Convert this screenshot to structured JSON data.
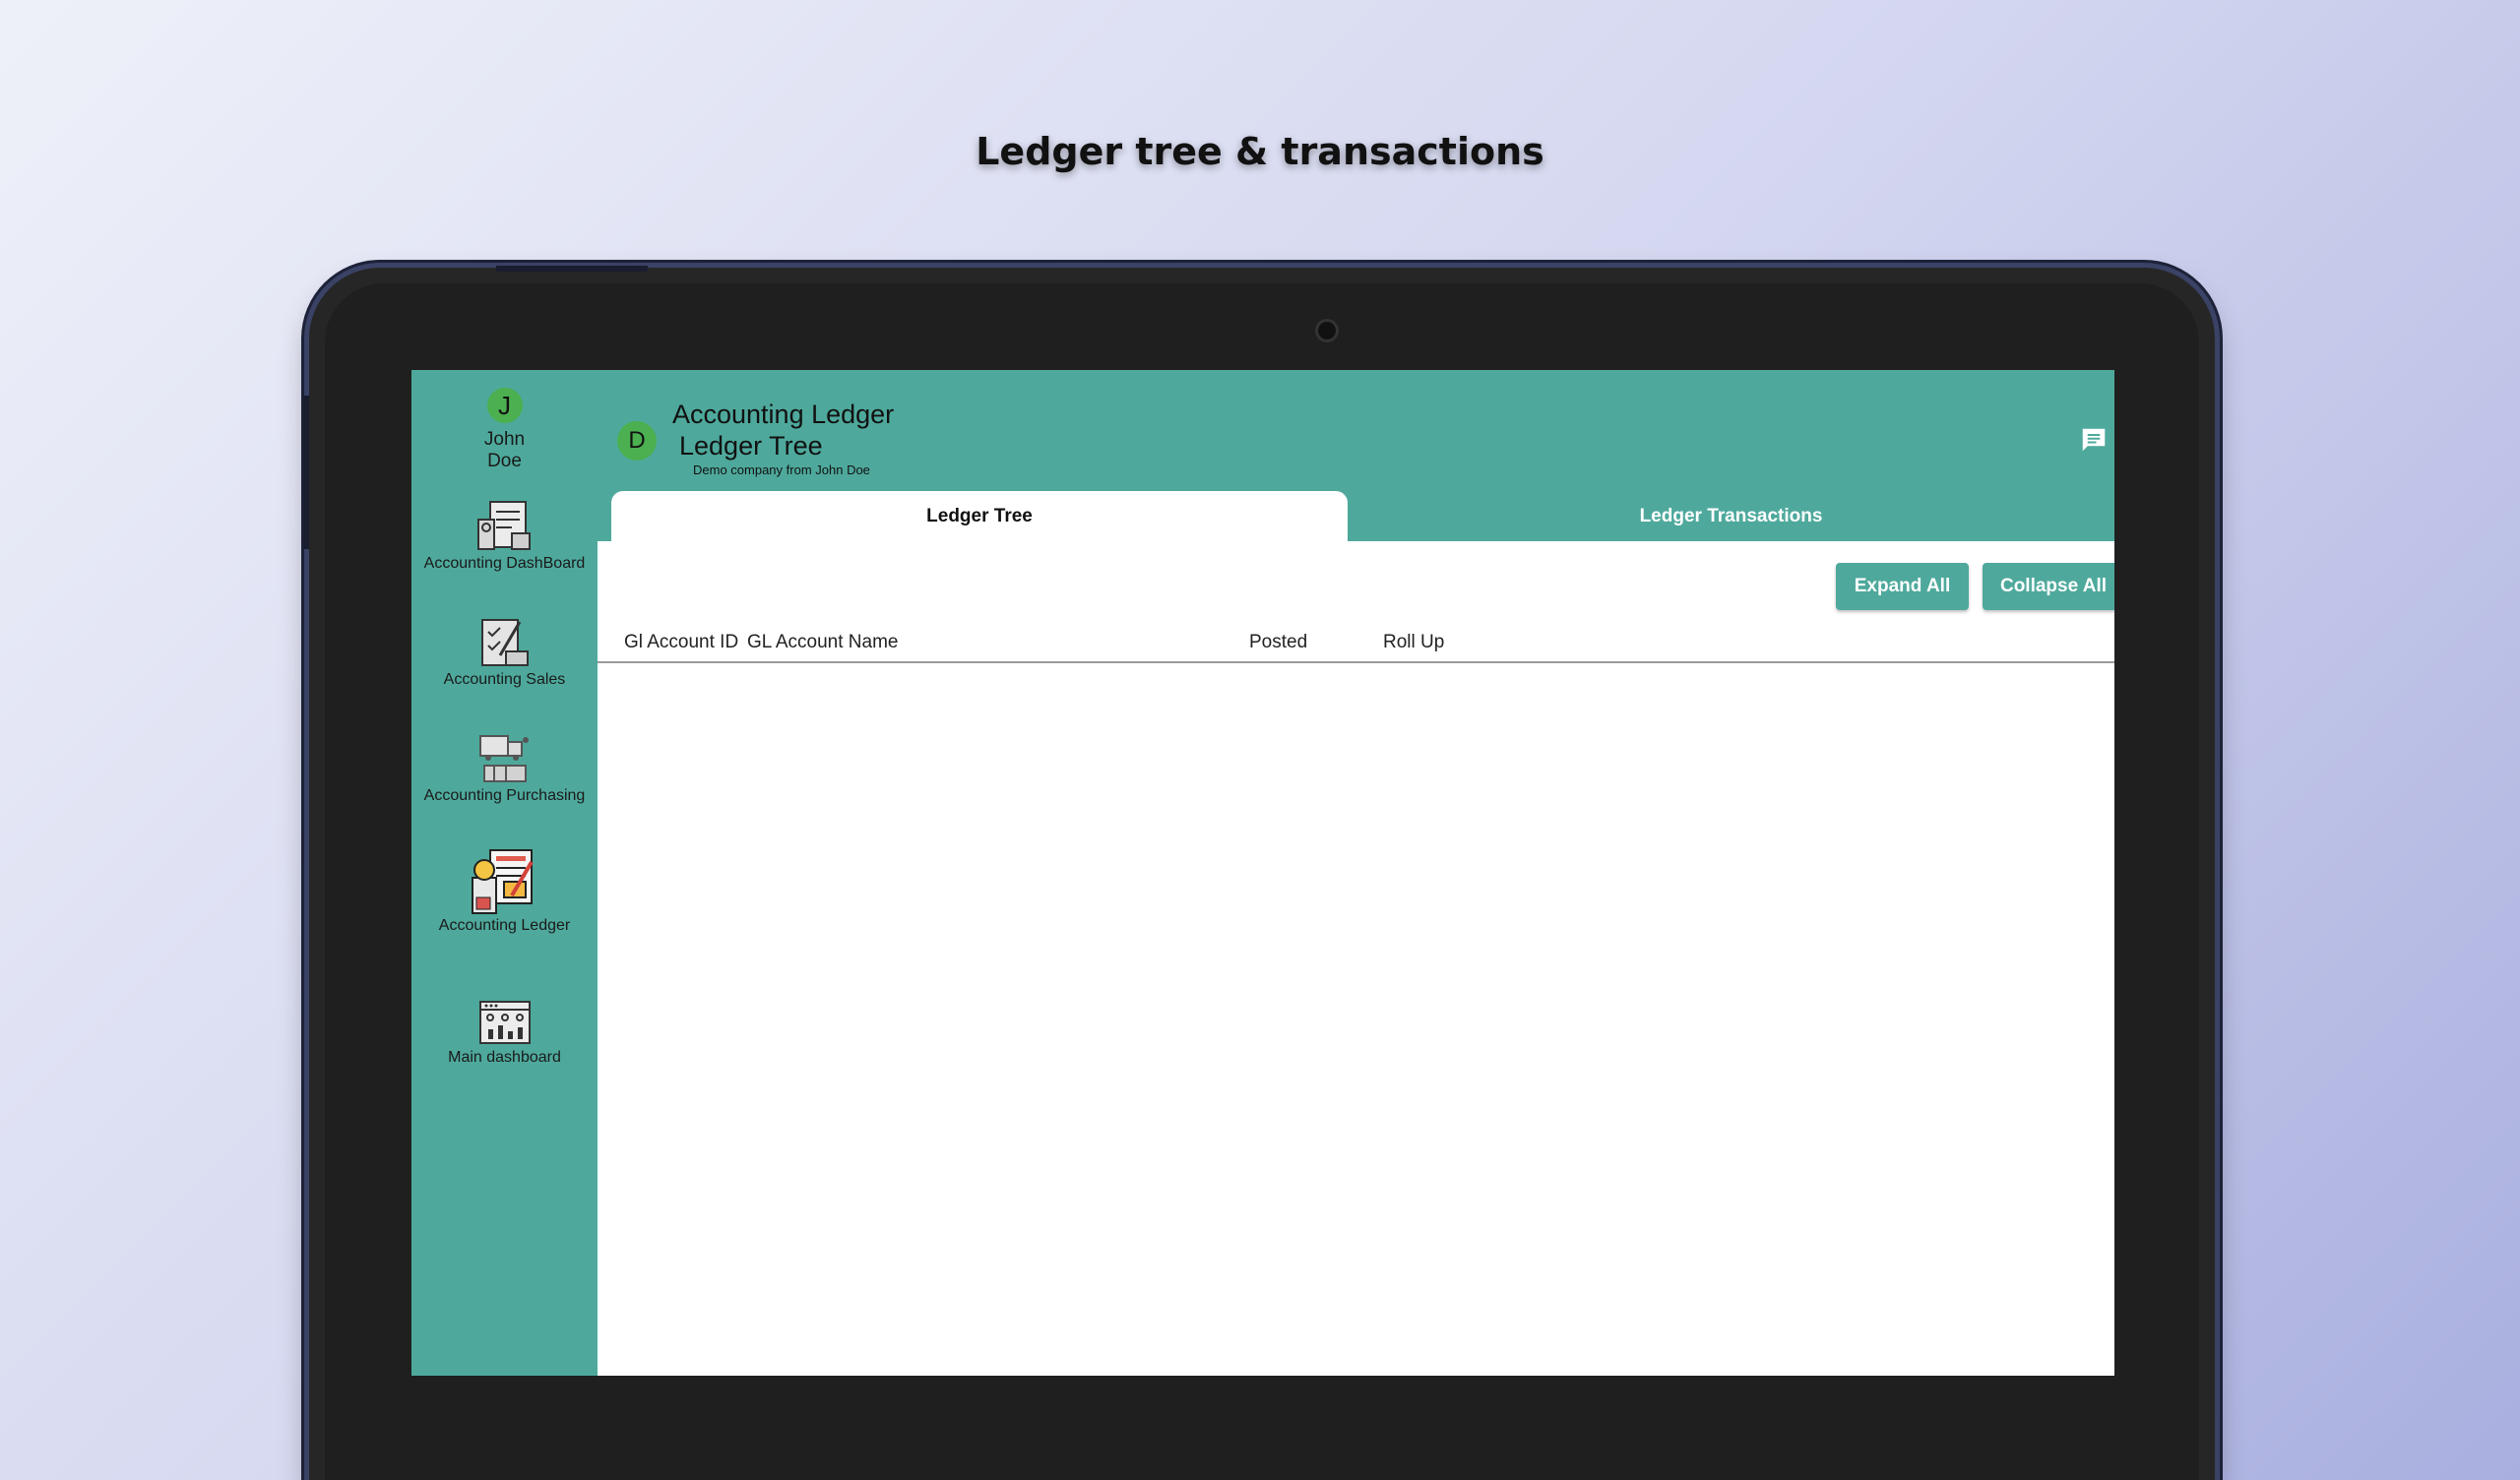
{
  "headline": "Ledger tree & transactions",
  "sidebar": {
    "user": {
      "initial": "J",
      "name": "John Doe"
    },
    "items": [
      {
        "label": "Accounting DashBoard",
        "icon": "accounting-dashboard-icon"
      },
      {
        "label": "Accounting Sales",
        "icon": "accounting-sales-icon"
      },
      {
        "label": "Accounting Purchasing",
        "icon": "accounting-purchasing-icon"
      },
      {
        "label": "Accounting Ledger",
        "icon": "accounting-ledger-icon"
      },
      {
        "label": "Main dashboard",
        "icon": "main-dashboard-icon"
      }
    ]
  },
  "header": {
    "company_initial": "D",
    "title": "Accounting Ledger",
    "subtitle_title": "Ledger Tree",
    "company_line": "Demo company from John Doe",
    "chat_icon": "chat-icon"
  },
  "tabs": [
    {
      "label": "Ledger Tree",
      "active": true
    },
    {
      "label": "Ledger Transactions",
      "active": false
    }
  ],
  "toolbar": {
    "expand_label": "Expand All",
    "collapse_label": "Collapse All"
  },
  "table": {
    "columns": [
      "Gl Account ID",
      "GL Account Name",
      "Posted",
      "Roll Up"
    ],
    "rows": []
  },
  "colors": {
    "primary": "#4ea99c",
    "avatar": "#4caf50",
    "bezel": "#262626"
  }
}
